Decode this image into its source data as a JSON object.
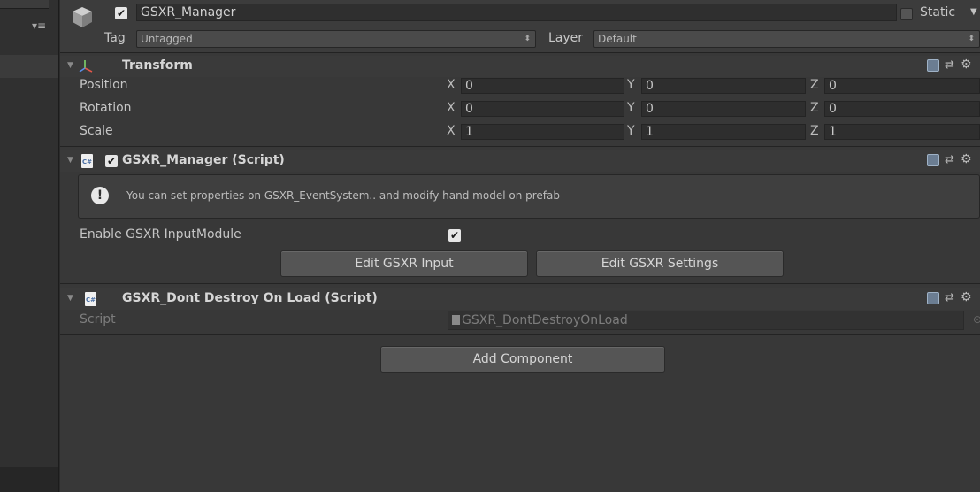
{
  "left_panel": {
    "menu_icon": "list-menu-icon"
  },
  "header": {
    "object_name": "GSXR_Manager",
    "active_checked": true,
    "static_label": "Static",
    "tag_label": "Tag",
    "tag_value": "Untagged",
    "layer_label": "Layer",
    "layer_value": "Default"
  },
  "transform": {
    "title": "Transform",
    "rows": [
      {
        "label": "Position",
        "x": "0",
        "y": "0",
        "z": "0"
      },
      {
        "label": "Rotation",
        "x": "0",
        "y": "0",
        "z": "0"
      },
      {
        "label": "Scale",
        "x": "1",
        "y": "1",
        "z": "1"
      }
    ],
    "axis_x": "X",
    "axis_y": "Y",
    "axis_z": "Z"
  },
  "manager_script": {
    "title": "GSXR_Manager (Script)",
    "enabled": true,
    "help_text": "You can set  properties on  GSXR_EventSystem.. and modify hand model on prefab",
    "enable_input_label": "Enable GSXR InputModule",
    "enable_input_checked": true,
    "edit_input_button": "Edit GSXR Input",
    "edit_settings_button": "Edit GSXR Settings"
  },
  "dont_destroy_script": {
    "title": "GSXR_Dont Destroy On Load (Script)",
    "script_label": "Script",
    "script_value": "GSXR_DontDestroyOnLoad"
  },
  "add_component_button": "Add Component",
  "colors": {
    "panel_bg": "#383838",
    "checkbox": "#e6e6e6",
    "csharp_icon": "#4a6fa5"
  }
}
